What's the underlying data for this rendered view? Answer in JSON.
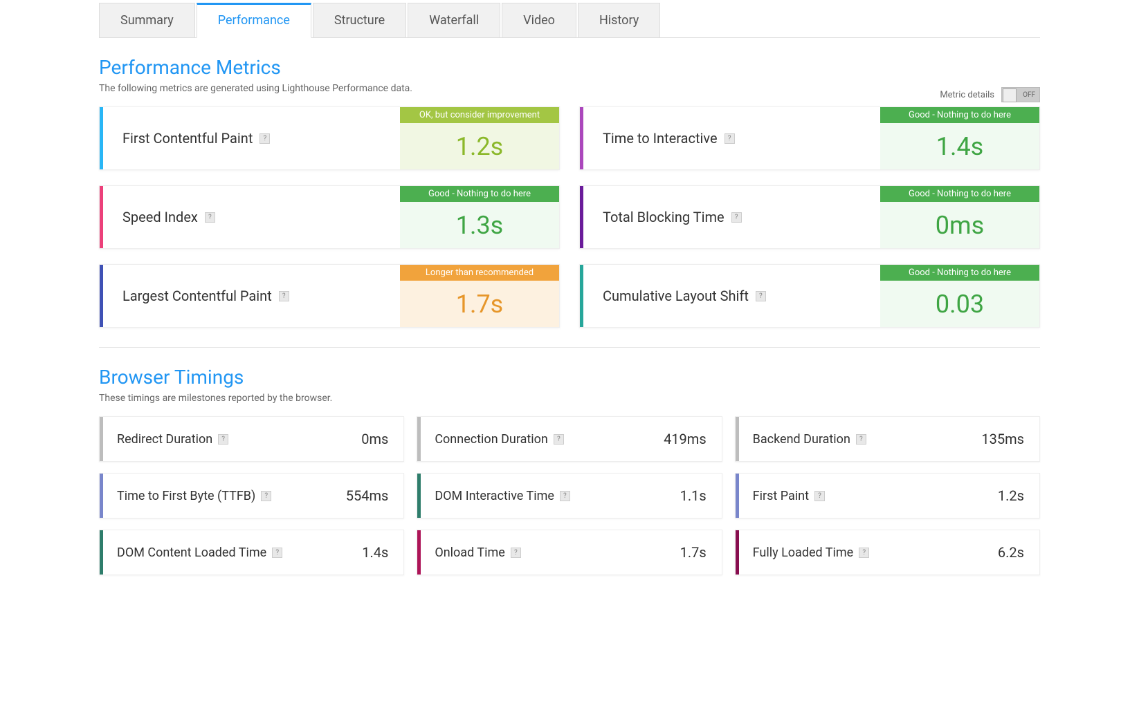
{
  "tabs": [
    "Summary",
    "Performance",
    "Structure",
    "Waterfall",
    "Video",
    "History"
  ],
  "active_tab": "Performance",
  "perf": {
    "title": "Performance Metrics",
    "subtitle": "The following metrics are generated using Lighthouse Performance data.",
    "metric_details_label": "Metric details",
    "toggle_state": "OFF",
    "metrics": [
      {
        "name": "First Contentful Paint",
        "status": "OK, but consider improvement",
        "value": "1.2s",
        "variant": "ok",
        "accent": "cyan"
      },
      {
        "name": "Time to Interactive",
        "status": "Good - Nothing to do here",
        "value": "1.4s",
        "variant": "good",
        "accent": "purple"
      },
      {
        "name": "Speed Index",
        "status": "Good - Nothing to do here",
        "value": "1.3s",
        "variant": "good",
        "accent": "pink"
      },
      {
        "name": "Total Blocking Time",
        "status": "Good - Nothing to do here",
        "value": "0ms",
        "variant": "good",
        "accent": "darkpurple"
      },
      {
        "name": "Largest Contentful Paint",
        "status": "Longer than recommended",
        "value": "1.7s",
        "variant": "warn",
        "accent": "blue"
      },
      {
        "name": "Cumulative Layout Shift",
        "status": "Good - Nothing to do here",
        "value": "0.03",
        "variant": "good",
        "accent": "teal"
      }
    ]
  },
  "timings": {
    "title": "Browser Timings",
    "subtitle": "These timings are milestones reported by the browser.",
    "items": [
      {
        "name": "Redirect Duration",
        "value": "0ms",
        "accent": "gray"
      },
      {
        "name": "Connection Duration",
        "value": "419ms",
        "accent": "gray"
      },
      {
        "name": "Backend Duration",
        "value": "135ms",
        "accent": "gray"
      },
      {
        "name": "Time to First Byte (TTFB)",
        "value": "554ms",
        "accent": "slate"
      },
      {
        "name": "DOM Interactive Time",
        "value": "1.1s",
        "accent": "darkteal"
      },
      {
        "name": "First Paint",
        "value": "1.2s",
        "accent": "slate"
      },
      {
        "name": "DOM Content Loaded Time",
        "value": "1.4s",
        "accent": "darkteal"
      },
      {
        "name": "Onload Time",
        "value": "1.7s",
        "accent": "darkpink"
      },
      {
        "name": "Fully Loaded Time",
        "value": "6.2s",
        "accent": "maroon"
      }
    ]
  }
}
